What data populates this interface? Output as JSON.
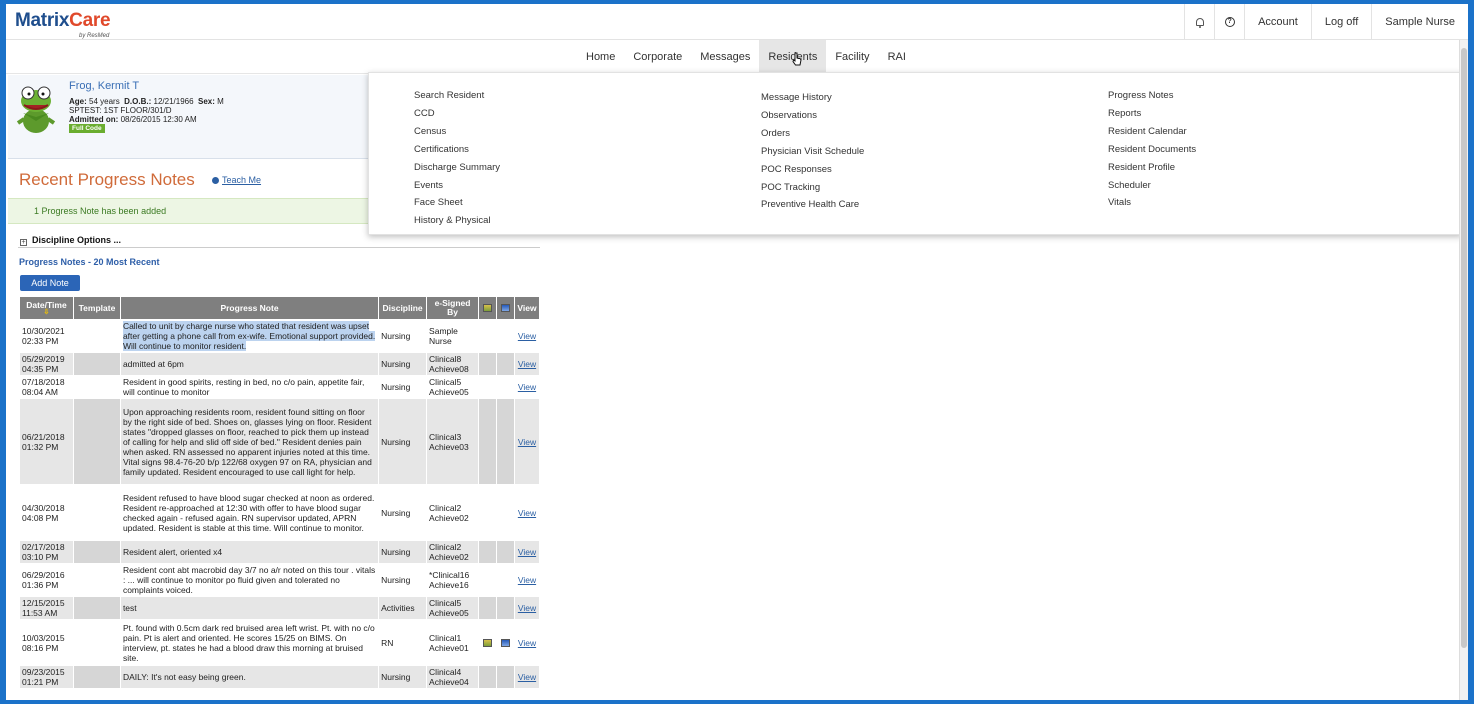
{
  "app": {
    "logo_main": "Matrix",
    "logo_accent": "Care",
    "logo_sub": "by ResMed"
  },
  "topbar": {
    "notifications_icon": "bell-icon",
    "help_icon": "help-icon",
    "help_glyph": "?",
    "account": "Account",
    "logoff": "Log off",
    "user": "Sample Nurse"
  },
  "nav": {
    "tabs": [
      "Home",
      "Corporate",
      "Messages",
      "Residents",
      "Facility",
      "RAI"
    ],
    "active": "Residents"
  },
  "resident": {
    "name": "Frog, Kermit T",
    "age_label": "Age:",
    "age": "54 years",
    "dob_label": "D.O.B.:",
    "dob": "12/21/1966",
    "sex_label": "Sex:",
    "sex": "M",
    "location": "SPTEST: 1ST FLOOR/301/D",
    "admitted_label": "Admitted on:",
    "admitted": "08/26/2015 12:30 AM",
    "code_status": "Full Code"
  },
  "notes_page": {
    "title": "Recent Progress Notes",
    "teach_me": "Teach Me",
    "added_message": "1 Progress Note has been added",
    "discipline_options": "Discipline Options ...",
    "expand_glyph": "+",
    "subtitle": "Progress Notes - 20 Most Recent",
    "add_note": "Add Note"
  },
  "table": {
    "headers": {
      "date": "Date/Time",
      "template": "Template",
      "note": "Progress Note",
      "discipline": "Discipline",
      "signed": "e-Signed By",
      "view": "View"
    },
    "sort_glyph": "⇩",
    "rows": [
      {
        "date": "10/30/2021",
        "time": "02:33 PM",
        "note": "Called to unit by charge nurse who stated that resident was upset after getting a phone call from ex-wife. Emotional support provided. Will continue to monitor resident.",
        "discipline": "Nursing",
        "signed1": "Sample",
        "signed2": "Nurse",
        "view": "View",
        "flags": false
      },
      {
        "date": "05/29/2019",
        "time": "04:35 PM",
        "note": "admitted at 6pm",
        "discipline": "Nursing",
        "signed1": "Clinical8",
        "signed2": "Achieve08",
        "view": "View",
        "flags": false
      },
      {
        "date": "07/18/2018",
        "time": "08:04 AM",
        "note": "Resident in good spirits, resting in bed, no c/o pain, appetite fair, will continue to monitor",
        "discipline": "Nursing",
        "signed1": "Clinical5",
        "signed2": "Achieve05",
        "view": "View",
        "flags": false
      },
      {
        "date": "06/21/2018",
        "time": "01:32 PM",
        "note": "Upon approaching residents room, resident found sitting on floor by the right side of bed. Shoes on, glasses lying on floor. Resident states \"dropped glasses on floor, reached to pick them up instead of calling for help and slid off side of bed.\" Resident denies pain when asked. RN assessed no apparent injuries noted at this time. Vital signs 98.4-76-20 b/p 122/68 oxygen 97 on RA, physician and family updated. Resident encouraged to use call light for help.",
        "discipline": "Nursing",
        "signed1": "Clinical3",
        "signed2": "Achieve03",
        "view": "View",
        "flags": false
      },
      {
        "date": "04/30/2018",
        "time": "04:08 PM",
        "note": "Resident refused to have blood sugar checked at noon as ordered. Resident re-approached at 12:30 with offer to have blood sugar checked again - refused again. RN supervisor updated, APRN updated. Resident is stable at this time. Will continue to monitor.",
        "discipline": "Nursing",
        "signed1": "Clinical2",
        "signed2": "Achieve02",
        "view": "View",
        "flags": false
      },
      {
        "date": "02/17/2018",
        "time": "03:10 PM",
        "note": "Resident alert, oriented x4",
        "discipline": "Nursing",
        "signed1": "Clinical2",
        "signed2": "Achieve02",
        "view": "View",
        "flags": false
      },
      {
        "date": "06/29/2016",
        "time": "01:36 PM",
        "note": "Resident cont abt macrobid day 3/7 no a/r noted on this tour . vitals : ... will continue to monitor po fluid given and tolerated no complaints voiced.",
        "discipline": "Nursing",
        "signed1": "*Clinical16",
        "signed2": "Achieve16",
        "view": "View",
        "flags": false
      },
      {
        "date": "12/15/2015",
        "time": "11:53 AM",
        "note": "test",
        "discipline": "Activities",
        "signed1": "Clinical5",
        "signed2": "Achieve05",
        "view": "View",
        "flags": false
      },
      {
        "date": "10/03/2015",
        "time": "08:16 PM",
        "note": "Pt. found with 0.5cm dark red bruised area left wrist. Pt. with no c/o pain. Pt is alert and oriented. He scores 15/25 on BIMS. On interview, pt. states he had a blood draw this morning at bruised site.",
        "discipline": "RN",
        "signed1": "Clinical1",
        "signed2": "Achieve01",
        "view": "View",
        "flags": true
      },
      {
        "date": "09/23/2015",
        "time": "01:21 PM",
        "note": "DAILY: It's not easy being green.",
        "discipline": "Nursing",
        "signed1": "Clinical4",
        "signed2": "Achieve04",
        "view": "View",
        "flags": false
      }
    ]
  },
  "dropdown": {
    "col1": [
      "Search Resident",
      "CCD",
      "Census",
      "Certifications",
      "Discharge Summary",
      "Events",
      "Face Sheet",
      "History & Physical"
    ],
    "col2": [
      "Message History",
      "Observations",
      "Orders",
      "Physician Visit Schedule",
      "POC Responses",
      "POC Tracking",
      "Preventive Health Care"
    ],
    "col3": [
      "Progress Notes",
      "Reports",
      "Resident Calendar",
      "Resident Documents",
      "Resident Profile",
      "Scheduler",
      "Vitals"
    ]
  },
  "colors": {
    "brand_blue": "#1f4e8d",
    "brand_orange": "#e0492b",
    "title_orange": "#d06b3a",
    "link_blue": "#2b5fa3",
    "success_green": "#3b7a22"
  }
}
